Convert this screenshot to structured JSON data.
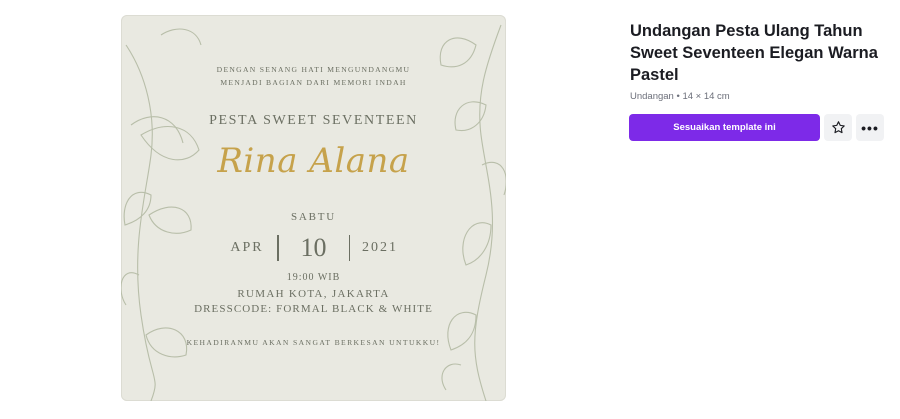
{
  "template": {
    "title": "Undangan Pesta Ulang Tahun Sweet Seventeen Elegan Warna Pastel",
    "meta": "Undangan • 14 × 14 cm",
    "customize_label": "Sesuaikan template ini",
    "more_label": "•••",
    "icons": {
      "favorite": "star-outline-icon",
      "more": "more-horizontal-icon"
    },
    "colors": {
      "primary": "#7d2ae8",
      "card_bg": "#e9e9e1",
      "gold": "#c6a24b",
      "text": "#6b6f62"
    }
  },
  "card": {
    "intro_line1": "DENGAN SENANG HATI MENGUNDANGMU",
    "intro_line2": "MENJADI BAGIAN DARI MEMORI INDAH",
    "event": "PESTA SWEET SEVENTEEN",
    "name": "Rina Alana",
    "day": "SABTU",
    "month": "APR",
    "date": "10",
    "year": "2021",
    "time": "19:00 WIB",
    "venue": "RUMAH KOTA, JAKARTA",
    "dresscode": "DRESSCODE: FORMAL BLACK & WHITE",
    "closing": "KEHADIRANMU AKAN SANGAT BERKESAN UNTUKKU!"
  }
}
